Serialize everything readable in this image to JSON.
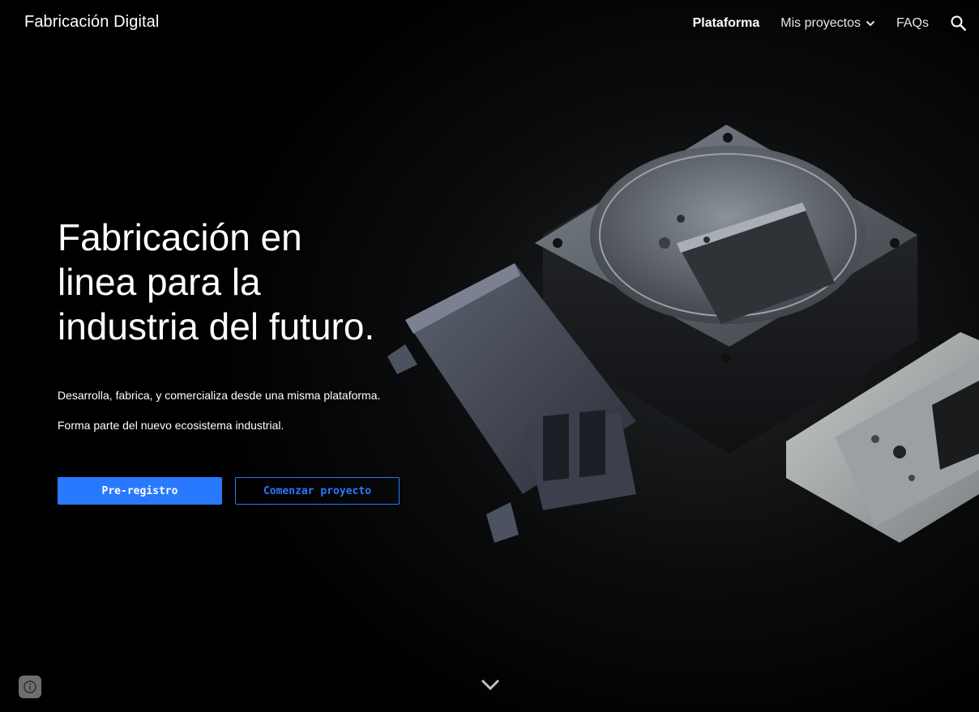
{
  "header": {
    "site_title": "Fabricación Digital",
    "nav": [
      {
        "label": "Plataforma",
        "active": true
      },
      {
        "label": "Mis proyectos",
        "has_dropdown": true
      },
      {
        "label": "FAQs"
      }
    ],
    "search_icon": "search-icon"
  },
  "hero": {
    "title_lines": [
      "Fabricación en",
      "linea para la",
      "industria del futuro."
    ],
    "subtitle_1": "Desarrolla, fabrica, y comercializa desde una misma plataforma.",
    "subtitle_2": "Forma parte del nuevo ecosistema industrial.",
    "primary_button": "Pre-registro",
    "secondary_button": "Comenzar proyecto"
  },
  "colors": {
    "accent": "#2979ff",
    "background": "#000000",
    "text": "#ffffff"
  },
  "footer": {
    "scroll_icon": "chevron-down-icon",
    "info_icon": "info-icon"
  }
}
